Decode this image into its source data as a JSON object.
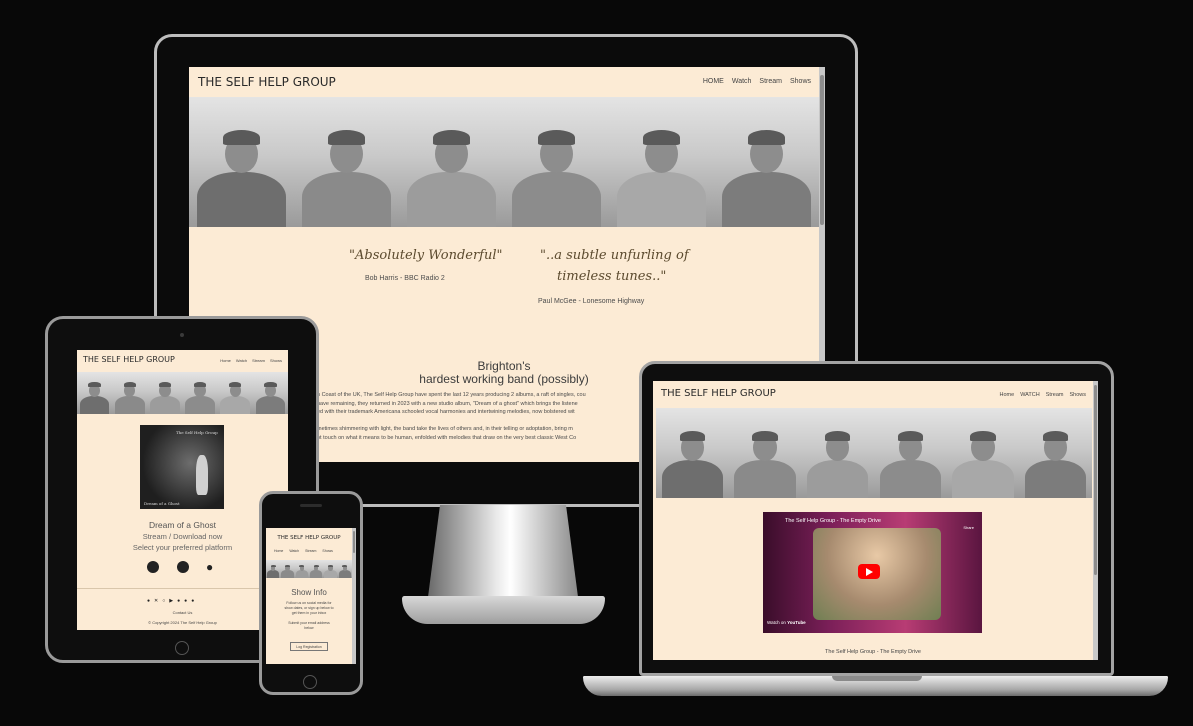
{
  "site": {
    "title": "THE SELF HELP GROUP",
    "copyright": "© Copyright 2024 The Self Help Group"
  },
  "desktop": {
    "nav": [
      "HOME",
      "Watch",
      "Stream",
      "Shows"
    ],
    "quotes": [
      {
        "text": "\"Absolutely Wonderful\"",
        "source": "Bob Harris - BBC Radio 2"
      },
      {
        "text_line1": "\"..a subtle unfurling of",
        "text_line2": "timeless tunes..\"",
        "source": "Paul McGee - Lonesome Highway"
      }
    ],
    "headline_line1": "Brighton's",
    "headline_line2": "hardest working band (possibly)",
    "body_lines": [
      "h Coast of the UK, The Self Help Group have spent the last 12 years producing 2 albums, a raft of singles, cou",
      "have remaining, they returned in 2023 with a new studio album, \"Dream of a ghost\" which brings the listene",
      "ed with their trademark Americana schooled vocal harmonies and intertwining melodies, now bolstered wit",
      "",
      "metimes shimmering with light, the band take the lives of others and, in their telling or adoptation, bring m",
      "ot touch on what it means to be human, enfolded with melodies that draw on the very best classic West Co"
    ]
  },
  "tablet": {
    "nav": [
      "Home",
      "Watch",
      "Stream",
      "Shows"
    ],
    "album_cover_text": "The Self Help Group",
    "album_cover_caption": "Dream of a Ghost",
    "album_title": "Dream of a Ghost",
    "stream_line": "Stream / Download now",
    "platform_line": "Select your preferred platform",
    "contact_label": "Contact Us"
  },
  "phone": {
    "title": "THE SELF HELP GROUP",
    "nav": [
      "Home",
      "Watch",
      "Stream",
      "Shows"
    ],
    "heading": "Show Info",
    "text_lines": [
      "Follow us on social media for",
      "show dates, or sign up below to",
      "get them in your inbox"
    ],
    "submit_lines": [
      "Submit your email address",
      "below"
    ],
    "button": "Log Registration"
  },
  "laptop": {
    "nav": [
      "Home",
      "WATCH",
      "Stream",
      "Shows"
    ],
    "video_title": "The Self Help Group - The Empty Drive",
    "video_share": "Share",
    "video_watch_on": "Watch on",
    "video_brand": "YouTube",
    "caption": "The Self Help Group - The Empty Drive"
  },
  "colors": {
    "page_bg": "#080808",
    "site_bg": "#fcebd5",
    "youtube_red": "#ff0000"
  },
  "icons": [
    "spotify-icon",
    "apple-icon",
    "stream-icon",
    "facebook-icon",
    "x-icon",
    "instagram-icon",
    "play-icon"
  ]
}
